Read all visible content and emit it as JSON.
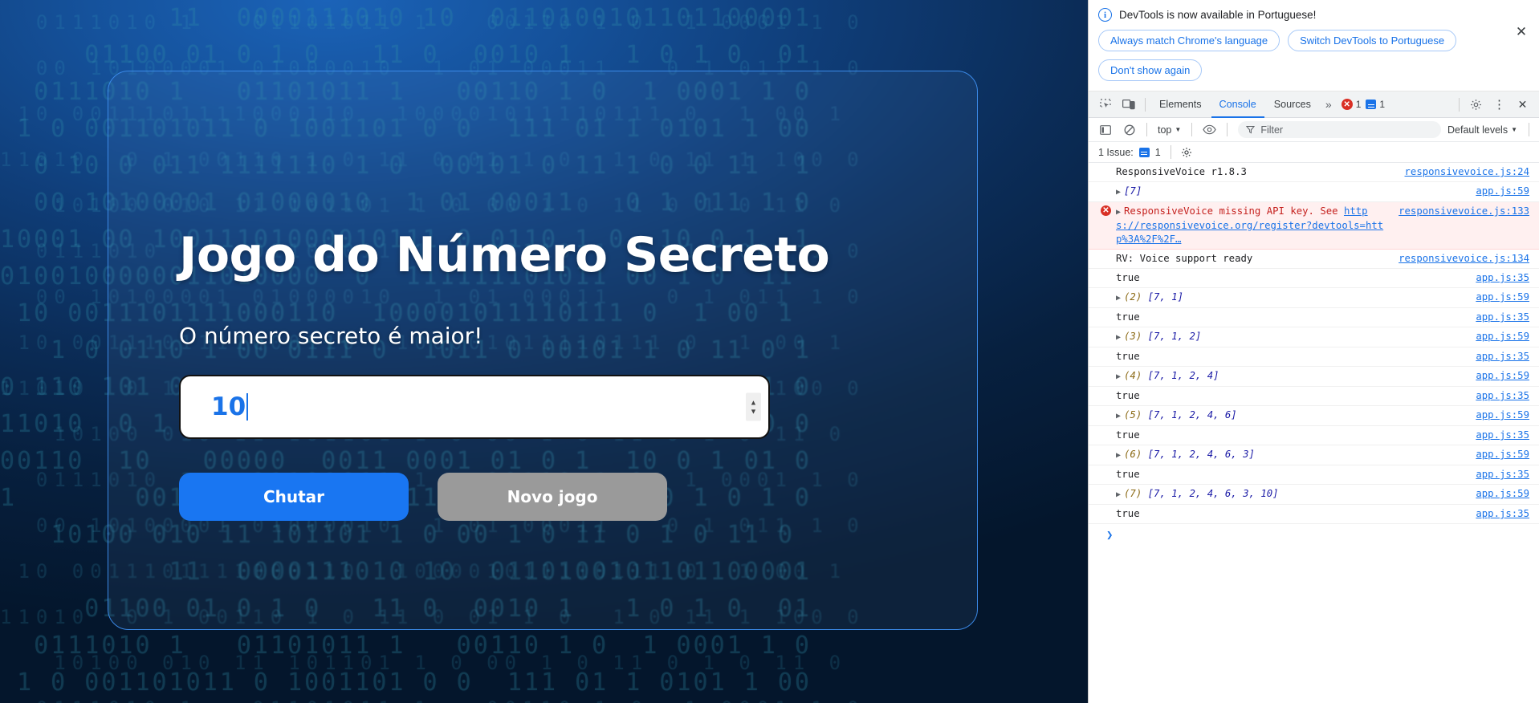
{
  "game": {
    "title": "Jogo do Número Secreto",
    "message": "O número secreto é maior!",
    "input_value": "10",
    "buttons": {
      "guess": "Chutar",
      "new_game": "Novo jogo"
    },
    "spinner": {
      "up": "▲",
      "down": "▼"
    }
  },
  "devtools": {
    "notice": {
      "text": "DevTools is now available in Portuguese!",
      "info_icon": "i",
      "close_icon": "✕",
      "buttons": [
        "Always match Chrome's language",
        "Switch DevTools to Portuguese",
        "Don't show again"
      ]
    },
    "tabbar": {
      "tabs": [
        "Elements",
        "Console",
        "Sources"
      ],
      "active_tab": "Console",
      "more_icon": "»",
      "error_count": "1",
      "message_count": "1",
      "gear_icon": "⚙",
      "kebab_icon": "⋮",
      "close_icon": "✕"
    },
    "consolebar": {
      "context": "top",
      "chevron": "▼",
      "filter_placeholder": "Filter",
      "levels": "Default levels",
      "levels_chevron": "▼"
    },
    "issuebar": {
      "label": "1 Issue:",
      "count": "1",
      "gear_icon": "⚙"
    },
    "prompt": "❯",
    "logs": [
      {
        "type": "log",
        "text": "ResponsiveVoice r1.8.3",
        "source": "responsivevoice.js:24"
      },
      {
        "type": "array",
        "disclosure": "▶",
        "name": "",
        "value": "[7]",
        "source": "app.js:59"
      },
      {
        "type": "error",
        "disclosure": "▶",
        "text": "ResponsiveVoice missing API key. See ",
        "link": "https://responsivevoice.org/register?devtools=http%3A%2F%2F…",
        "source": "responsivevoice.js:133"
      },
      {
        "type": "log",
        "text": "RV: Voice support ready",
        "source": "responsivevoice.js:134"
      },
      {
        "type": "log",
        "text": "true",
        "source": "app.js:35"
      },
      {
        "type": "array",
        "disclosure": "▶",
        "name": "(2) ",
        "value": "[7, 1]",
        "source": "app.js:59"
      },
      {
        "type": "log",
        "text": "true",
        "source": "app.js:35"
      },
      {
        "type": "array",
        "disclosure": "▶",
        "name": "(3) ",
        "value": "[7, 1, 2]",
        "source": "app.js:59"
      },
      {
        "type": "log",
        "text": "true",
        "source": "app.js:35"
      },
      {
        "type": "array",
        "disclosure": "▶",
        "name": "(4) ",
        "value": "[7, 1, 2, 4]",
        "source": "app.js:59"
      },
      {
        "type": "log",
        "text": "true",
        "source": "app.js:35"
      },
      {
        "type": "array",
        "disclosure": "▶",
        "name": "(5) ",
        "value": "[7, 1, 2, 4, 6]",
        "source": "app.js:59"
      },
      {
        "type": "log",
        "text": "true",
        "source": "app.js:35"
      },
      {
        "type": "array",
        "disclosure": "▶",
        "name": "(6) ",
        "value": "[7, 1, 2, 4, 6, 3]",
        "source": "app.js:59"
      },
      {
        "type": "log",
        "text": "true",
        "source": "app.js:35"
      },
      {
        "type": "array",
        "disclosure": "▶",
        "name": "(7) ",
        "value": "[7, 1, 2, 4, 6, 3, 10]",
        "source": "app.js:59"
      },
      {
        "type": "log",
        "text": "true",
        "source": "app.js:35"
      }
    ]
  },
  "background": {
    "binary_rows": [
      "          11  0000111010 10  0110100101101100001",
      "     01100 01 0 1 0   11 0  0010 1   1 0 1 0  01",
      "  0111010 1   01101011 1   00110 1 0  1 0001 1 0",
      " 1 0 001101011 0 1001101 0 0  111 01 1 0101 1 00",
      "  0 10 0 011 1111110 1 0  00101 0 11 1 0 0 11  1",
      "  00 10100001 01000010  1 01 00011   0 1 011 1 0",
      "10001 00 10011101000010111 0 0110 1 0  10 0 1  1",
      "0100100000011010000  0  111111101011 00 1 0  11 ",
      " 10 0011101111000110  100001011110111 0  1 00 1 ",
      "   1 0 0110 1 00 0111 0  1011 0 00101 1 0 11 0 1",
      "0 110 101 0 0 1101 0001011 0 11 0 0 1 00 1 0 1 0",
      "11010  0 1 00110 1 0 11 0 01 1 0  1 0 11 1 100 0",
      "00110  10   00000  0011 0001 01 0 1  10 0 1 01 0",
      "1       0011 0 01111  101101 0001 1 0  0 1 0 1 0",
      "   10100 010 11 101101 1 0 00 1 0 11 0 1 0 11 0 "
    ]
  }
}
